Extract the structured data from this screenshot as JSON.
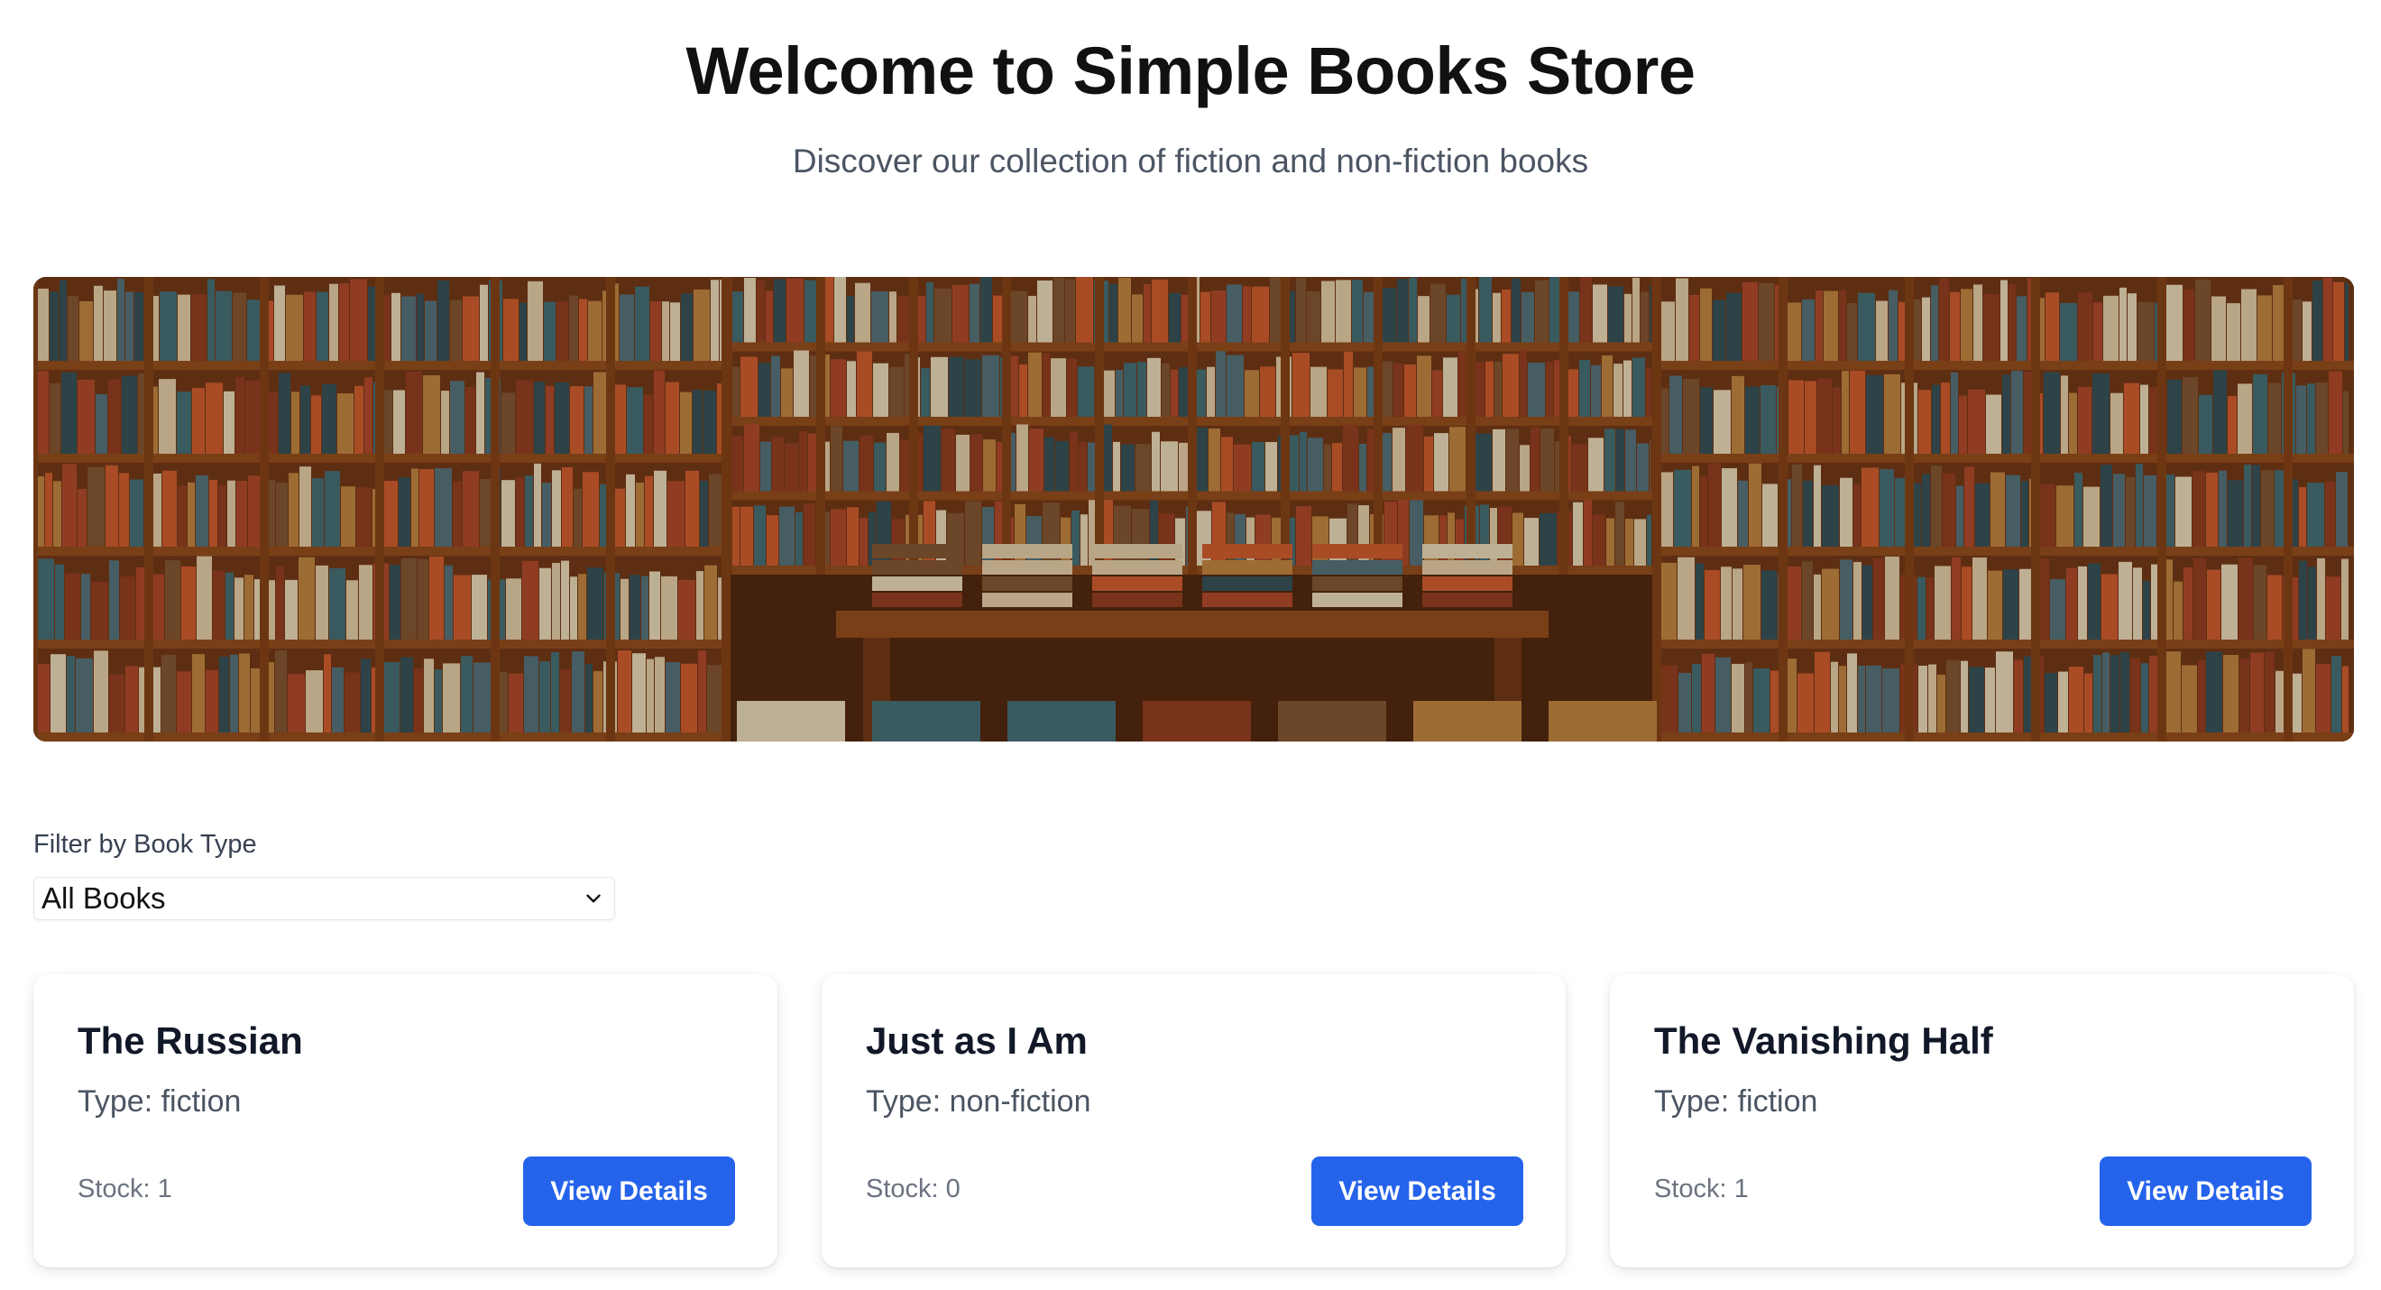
{
  "header": {
    "title": "Welcome to Simple Books Store",
    "subtitle": "Discover our collection of fiction and non-fiction books"
  },
  "filter": {
    "label": "Filter by Book Type",
    "selected": "All Books"
  },
  "books": [
    {
      "title": "The Russian",
      "type": "Type: fiction",
      "stock": "Stock: 1",
      "button": "View Details"
    },
    {
      "title": "Just as I Am",
      "type": "Type: non-fiction",
      "stock": "Stock: 0",
      "button": "View Details"
    },
    {
      "title": "The Vanishing Half",
      "type": "Type: fiction",
      "stock": "Stock: 1",
      "button": "View Details"
    }
  ],
  "colors": {
    "accent": "#2563eb",
    "shelf_wood": "#8b4a1c",
    "book_orange": "#c65a2e",
    "book_teal": "#3e6b73"
  },
  "icons": {
    "filter_dropdown": "chevron-down-icon",
    "hero": "bookshelf-image"
  }
}
